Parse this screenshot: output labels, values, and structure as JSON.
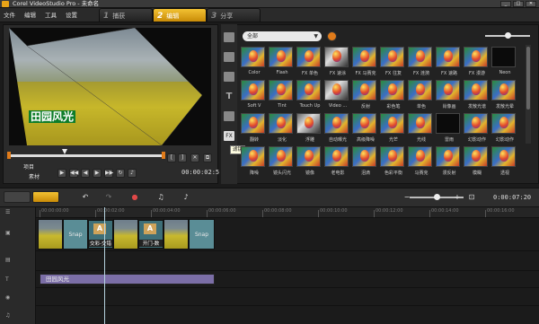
{
  "window": {
    "title": "Corel VideoStudio Pro - 未命名",
    "controls": [
      "_",
      "□",
      "✕"
    ]
  },
  "menu": [
    "文件",
    "编辑",
    "工具",
    "设置"
  ],
  "steps": [
    {
      "num": "1",
      "label": "捕获"
    },
    {
      "num": "2",
      "label": "编辑"
    },
    {
      "num": "3",
      "label": "分享"
    }
  ],
  "player": {
    "overlay_text": "田园风光",
    "project_label": "项目",
    "clip_label": "素材",
    "timecode": "00:00:02:5",
    "buttons": {
      "in": "[",
      "out": "]",
      "cut": "✕",
      "expand": "⧉"
    }
  },
  "library": {
    "category": "全部",
    "tooltip": "滤镜",
    "thumbnails": [
      "Color",
      "Flash",
      "FX 单色",
      "FX 速涂",
      "FX 马赛克",
      "FX 往复",
      "FX 涟漪",
      "FX 速路",
      "FX 漫游",
      "Neon",
      "Soft V",
      "Tint",
      "Touch Up",
      "Video ...",
      "反射",
      "彩色笔",
      "单色",
      "肖像画",
      "发散光谱",
      "发散光晕",
      "翻转",
      "淡化",
      "浮雕",
      "自动曝光",
      "高级降噪",
      "光芒",
      "光线",
      "雷雨",
      "幻影动作",
      "幻影动作",
      "降噪",
      "镜头闪光",
      "镜像",
      "老电影",
      "泪滴",
      "色彩平衡",
      "马赛克",
      "漫反射",
      "模糊",
      "透视"
    ]
  },
  "timeline": {
    "timecode": "0:00:07:20",
    "ruler_ticks": [
      "00:00:00:00",
      "00:00:02:00",
      "00:00:04:00",
      "00:00:06:00",
      "00:00:08:00",
      "00:00:10:00",
      "00:00:12:00",
      "00:00:14:00",
      "00:00:16:00"
    ],
    "clips": [
      {
        "kind": "field",
        "label": ""
      },
      {
        "kind": "snap",
        "label": "Snap"
      },
      {
        "kind": "field",
        "label": ""
      },
      {
        "kind": "field",
        "label": ""
      },
      {
        "kind": "snap",
        "label": "Snap"
      }
    ],
    "transitions": [
      {
        "label": "交彩-交错",
        "icon": "A"
      },
      {
        "label": "开门-数",
        "icon": "A"
      }
    ],
    "title_clip": "田园风光"
  },
  "colors": {
    "accent": "#e8a317",
    "title_clip": "#7b6ea6",
    "snap_clip": "#5a8d96"
  }
}
